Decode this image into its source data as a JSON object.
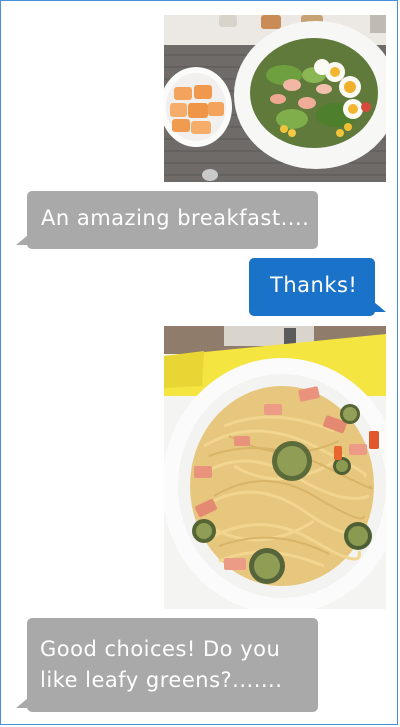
{
  "conversation": {
    "messages": [
      {
        "role": "attachment",
        "image": "salad-breakfast-photo"
      },
      {
        "role": "incoming",
        "text": "An amazing breakfast...."
      },
      {
        "role": "outgoing",
        "text": "Thanks!"
      },
      {
        "role": "attachment",
        "image": "spaghetti-photo"
      },
      {
        "role": "incoming",
        "text_line1": "Good choices! Do you",
        "text_line2": "like leafy greens?......."
      }
    ]
  },
  "colors": {
    "incoming_bubble": "#a9a9a9",
    "outgoing_bubble": "#1a73c9",
    "frame_border": "#4a90d9"
  }
}
